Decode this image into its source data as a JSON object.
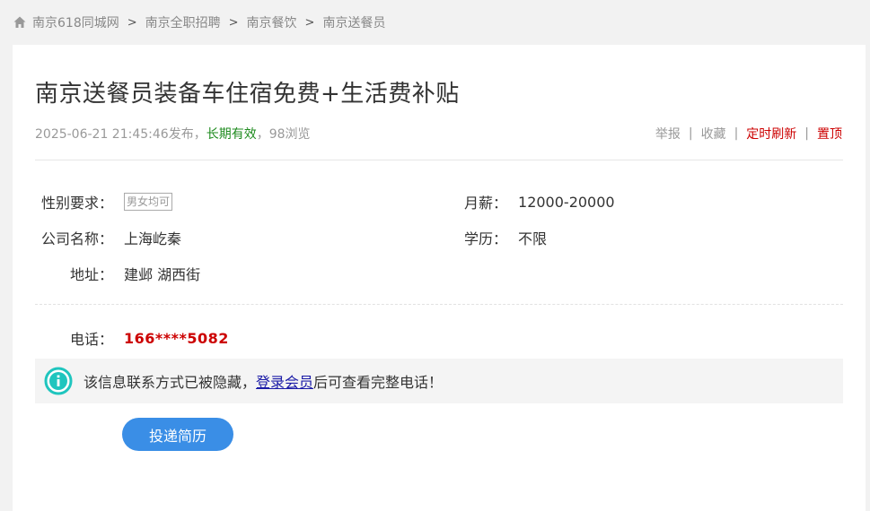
{
  "breadcrumb": {
    "items": [
      "南京618同城网",
      "南京全职招聘",
      "南京餐饮",
      "南京送餐员"
    ],
    "separator": ">"
  },
  "post": {
    "title": "南京送餐员装备车住宿免费+生活费补贴",
    "datetime": "2025-06-21 21:45:46发布，",
    "validity": "长期有效",
    "views": "，98浏览"
  },
  "actions": {
    "report": "举报",
    "favorite": "收藏",
    "scheduled_refresh": "定时刷新",
    "pin_top": "置顶",
    "separator": "|"
  },
  "fields": {
    "gender": {
      "label": "性别要求：",
      "value": "男女均可"
    },
    "salary": {
      "label": "月薪：",
      "value": "12000-20000"
    },
    "company": {
      "label": "公司名称：",
      "value": "上海屹秦"
    },
    "education": {
      "label": "学历：",
      "value": "不限"
    },
    "address": {
      "label": "地址：",
      "value": "建邺 湖西街"
    },
    "phone": {
      "label": "电话：",
      "value": "166****5082"
    }
  },
  "notice": {
    "prefix": "该信息联系方式已被隐藏，",
    "link": "登录会员",
    "suffix": "后可查看完整电话！"
  },
  "apply_button": "投递简历",
  "colors": {
    "accent_blue": "#3a8ee6",
    "alert_red": "#cc0000",
    "valid_green": "#1f8b1f",
    "info_teal": "#1fc5be"
  },
  "icons": {
    "breadcrumb": "home-icon",
    "notice": "info-icon"
  }
}
